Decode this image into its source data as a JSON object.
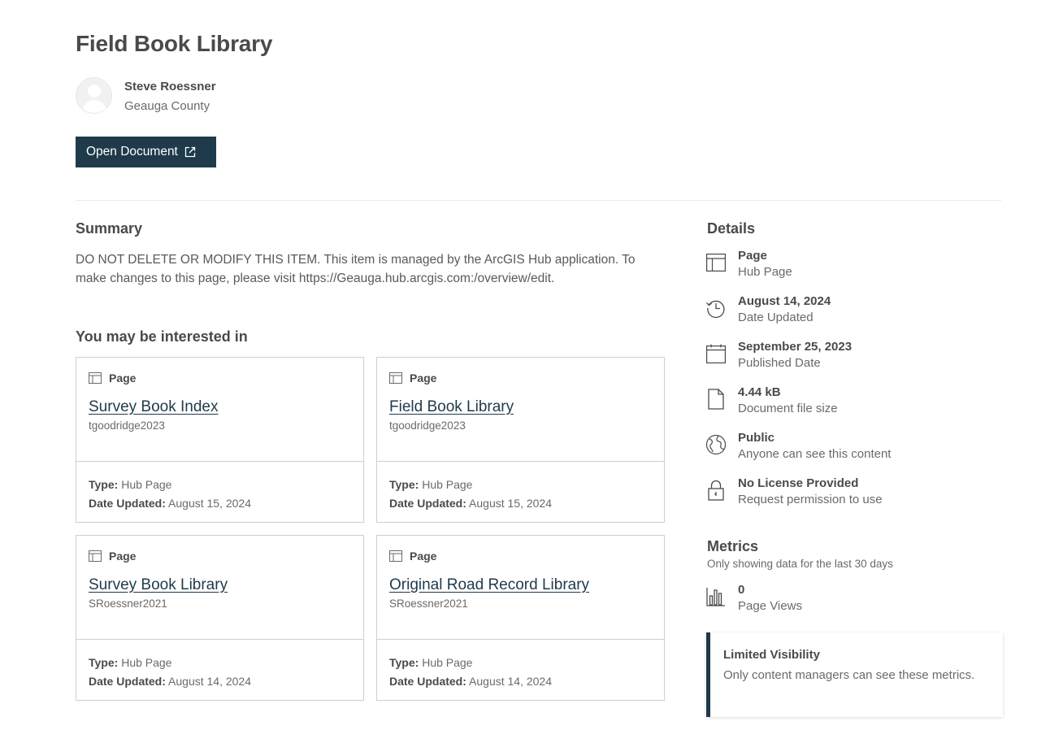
{
  "page": {
    "title": "Field Book Library"
  },
  "author": {
    "name": "Steve Roessner",
    "organization": "Geauga County"
  },
  "actions": {
    "open_document_label": "Open Document"
  },
  "summary": {
    "heading": "Summary",
    "text": "DO NOT DELETE OR MODIFY THIS ITEM. This item is managed by the ArcGIS Hub application. To make changes to this page, please visit https://Geauga.hub.arcgis.com:/overview/edit."
  },
  "related": {
    "heading": "You may be interested in",
    "type_label": "Type:",
    "date_label": "Date Updated:",
    "cards": [
      {
        "kind": "Page",
        "title": "Survey Book Index",
        "owner": "tgoodridge2023",
        "type": "Hub Page",
        "date_updated": "August 15, 2024"
      },
      {
        "kind": "Page",
        "title": "Field Book Library",
        "owner": "tgoodridge2023",
        "type": "Hub Page",
        "date_updated": "August 15, 2024"
      },
      {
        "kind": "Page",
        "title": "Survey Book Library",
        "owner": "SRoessner2021",
        "type": "Hub Page",
        "date_updated": "August 14, 2024"
      },
      {
        "kind": "Page",
        "title": "Original Road Record Library",
        "owner": "SRoessner2021",
        "type": "Hub Page",
        "date_updated": "August 14, 2024"
      }
    ]
  },
  "details": {
    "heading": "Details",
    "items": [
      {
        "icon": "page-layout-icon",
        "main": "Page",
        "sub": "Hub Page"
      },
      {
        "icon": "history-icon",
        "main": "August 14, 2024",
        "sub": "Date Updated"
      },
      {
        "icon": "calendar-icon",
        "main": "September 25, 2023",
        "sub": "Published Date"
      },
      {
        "icon": "file-icon",
        "main": "4.44 kB",
        "sub": "Document file size"
      },
      {
        "icon": "globe-icon",
        "main": "Public",
        "sub": "Anyone can see this content"
      },
      {
        "icon": "lock-icon",
        "main": "No License Provided",
        "sub": "Request permission to use"
      }
    ]
  },
  "metrics": {
    "heading": "Metrics",
    "note": "Only showing data for the last 30 days",
    "page_views_value": "0",
    "page_views_label": "Page Views"
  },
  "notice": {
    "title": "Limited Visibility",
    "text": "Only content managers can see these metrics."
  },
  "colors": {
    "primary": "#1f3a4a",
    "text": "#4a4a4a",
    "muted": "#6a6a6a",
    "border": "#cfcfcf"
  }
}
